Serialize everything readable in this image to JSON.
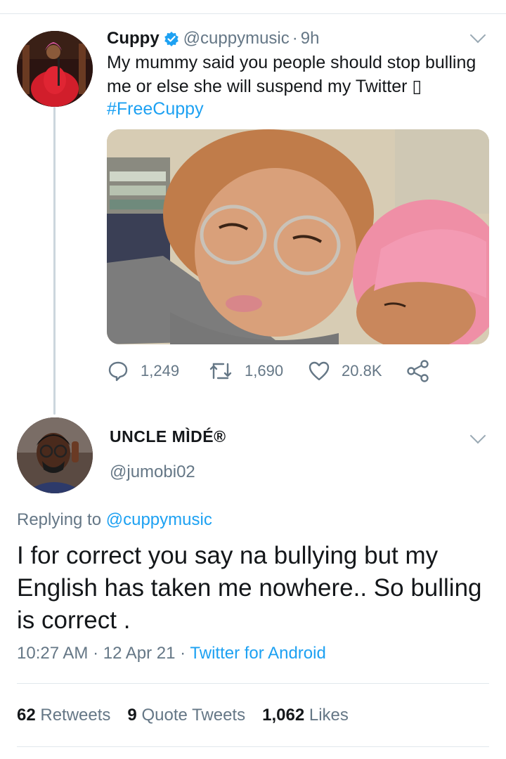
{
  "tweet": {
    "author_name": "Cuppy",
    "author_handle": "@cuppymusic",
    "separator": "·",
    "time_ago": "9h",
    "text": "My mummy said you people should stop bulling me or else she will suspend my Twitter ▯",
    "hashtag": "#FreeCuppy",
    "image_alt": "Selfie of a woman with round glasses and a person with pink hair resting on her shoulder",
    "actions": {
      "replies": "1,249",
      "retweets": "1,690",
      "likes": "20.8K"
    }
  },
  "reply": {
    "author_name": "UNCLE MÌDÉ®",
    "author_handle": "@jumobi02",
    "replying_prefix": "Replying to",
    "replying_to": "@cuppymusic",
    "text": "I for correct you say na bullying but my English has taken me nowhere.. So bulling is correct .",
    "time": "10:27 AM",
    "date": "12 Apr 21",
    "source": "Twitter for Android",
    "stats": {
      "retweets_count": "62",
      "retweets_label": "Retweets",
      "quotes_count": "9",
      "quotes_label": "Quote Tweets",
      "likes_count": "1,062",
      "likes_label": "Likes"
    }
  },
  "colors": {
    "accent": "#1da1f2",
    "secondary_text": "#657786",
    "divider": "#e1e8ed"
  },
  "icons": [
    "verified-badge-icon",
    "reply-icon",
    "retweet-icon",
    "like-icon",
    "share-icon",
    "chevron-down-icon"
  ]
}
